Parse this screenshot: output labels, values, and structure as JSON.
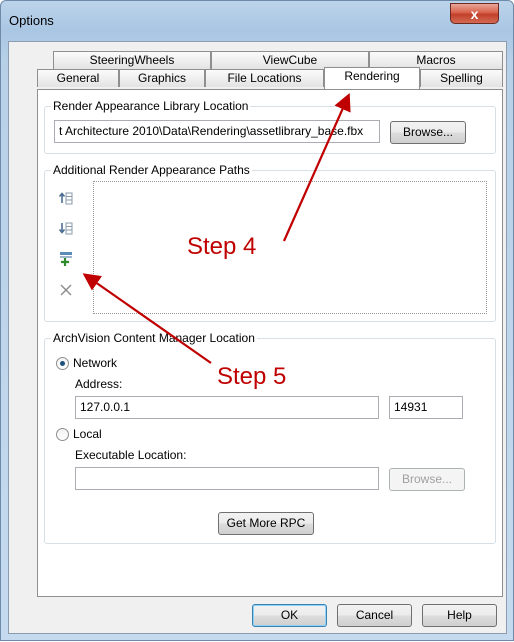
{
  "window": {
    "title": "Options",
    "close_label": "x"
  },
  "tabs": {
    "row1": [
      "SteeringWheels",
      "ViewCube",
      "Macros"
    ],
    "row2": [
      "General",
      "Graphics",
      "File Locations",
      "Rendering",
      "Spelling"
    ],
    "active": "Rendering"
  },
  "render_library": {
    "legend": "Render Appearance Library Location",
    "path": "t Architecture 2010\\Data\\Rendering\\assetlibrary_base.fbx",
    "browse_label": "Browse..."
  },
  "additional_paths": {
    "legend": "Additional Render Appearance Paths",
    "icons": [
      "move-up-icon",
      "move-down-icon",
      "add-path-icon",
      "remove-path-icon"
    ]
  },
  "archvision": {
    "legend": "ArchVision Content Manager Location",
    "network_label": "Network",
    "address_label": "Address:",
    "address_value": "127.0.0.1",
    "port_value": "14931",
    "local_label": "Local",
    "executable_label": "Executable Location:",
    "executable_value": "",
    "browse_label": "Browse...",
    "get_more_label": "Get More RPC",
    "selected": "Network"
  },
  "footer": {
    "ok_label": "OK",
    "cancel_label": "Cancel",
    "help_label": "Help"
  },
  "annotations": {
    "step4": "Step 4",
    "step5": "Step 5",
    "color": "#c00000"
  }
}
